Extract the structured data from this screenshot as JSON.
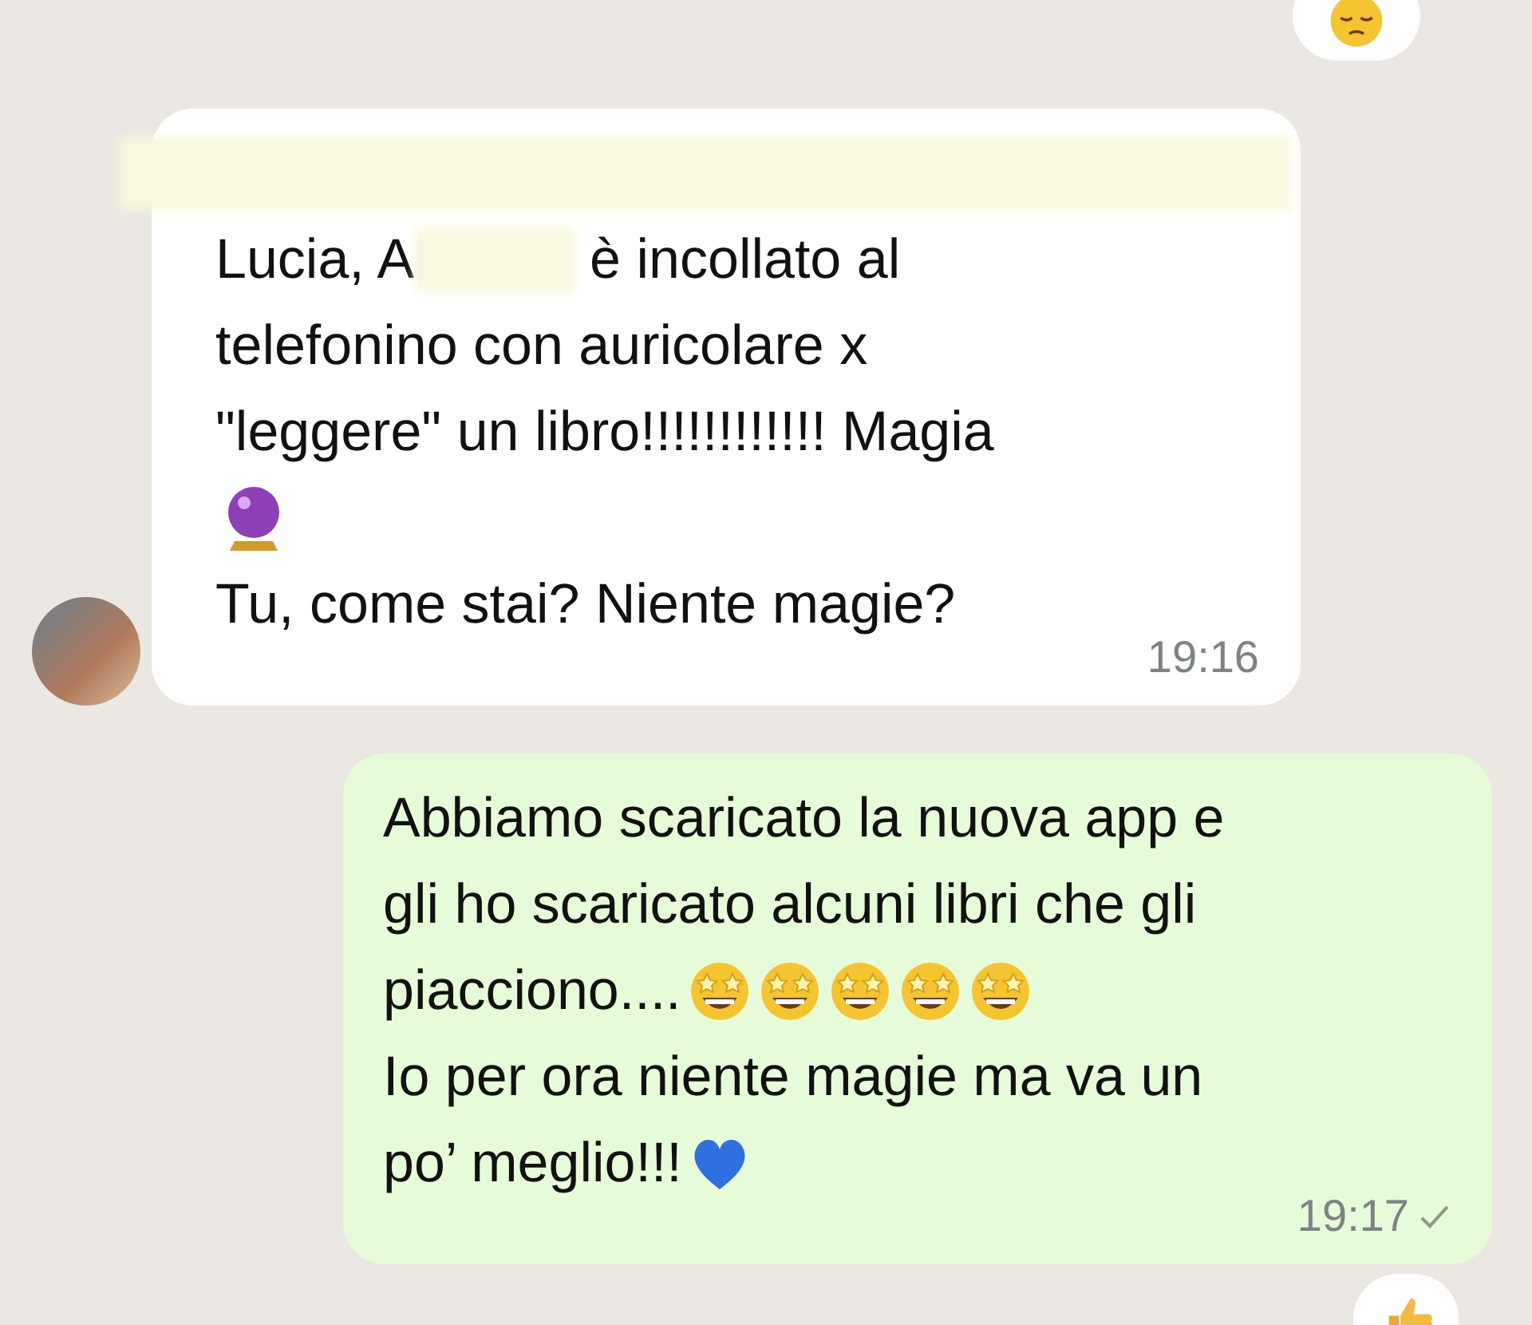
{
  "chat": {
    "top_reaction": {
      "kind": "pensive"
    },
    "messages": [
      {
        "outgoing": false,
        "time": "19:16",
        "lines": [
          [
            {
              "kind": "redaction"
            }
          ],
          [
            {
              "kind": "text",
              "text": "Lucia, A"
            },
            {
              "kind": "redaction"
            },
            {
              "kind": "text",
              "text": "è incollato al"
            }
          ],
          [
            {
              "kind": "text",
              "text": "telefonino con auricolare x"
            }
          ],
          [
            {
              "kind": "text",
              "text": "\"leggere\" un libro!!!!!!!!!!!! Magia"
            }
          ],
          [
            {
              "kind": "crystal-ball"
            }
          ],
          [
            {
              "kind": "text",
              "text": "Tu, come stai? Niente magie?"
            }
          ]
        ]
      },
      {
        "outgoing": true,
        "time": "19:17",
        "sent": true,
        "reaction": {
          "kind": "thumbs-up"
        },
        "lines": [
          [
            {
              "kind": "text",
              "text": "Abbiamo scaricato la nuova app e"
            }
          ],
          [
            {
              "kind": "text",
              "text": "gli ho scaricato alcuni libri che gli"
            }
          ],
          [
            {
              "kind": "text",
              "text": "piacciono...."
            },
            {
              "kind": "star-struck"
            },
            {
              "kind": "star-struck"
            },
            {
              "kind": "star-struck"
            },
            {
              "kind": "star-struck"
            },
            {
              "kind": "star-struck"
            }
          ],
          [
            {
              "kind": "text",
              "text": "Io per ora niente magie ma va un"
            }
          ],
          [
            {
              "kind": "text",
              "text": "po’ meglio!!!"
            },
            {
              "kind": "blue-heart"
            }
          ]
        ]
      }
    ]
  }
}
